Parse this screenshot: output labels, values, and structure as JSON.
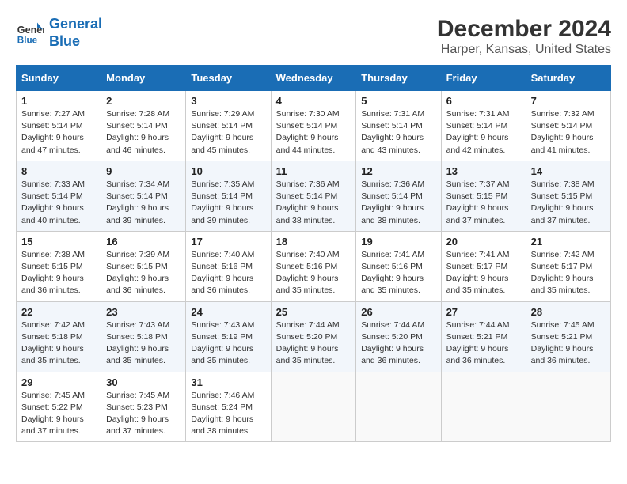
{
  "header": {
    "logo_line1": "General",
    "logo_line2": "Blue",
    "title": "December 2024",
    "subtitle": "Harper, Kansas, United States"
  },
  "calendar": {
    "days_of_week": [
      "Sunday",
      "Monday",
      "Tuesday",
      "Wednesday",
      "Thursday",
      "Friday",
      "Saturday"
    ],
    "weeks": [
      [
        {
          "day": "1",
          "sunrise": "7:27 AM",
          "sunset": "5:14 PM",
          "daylight": "9 hours and 47 minutes."
        },
        {
          "day": "2",
          "sunrise": "7:28 AM",
          "sunset": "5:14 PM",
          "daylight": "9 hours and 46 minutes."
        },
        {
          "day": "3",
          "sunrise": "7:29 AM",
          "sunset": "5:14 PM",
          "daylight": "9 hours and 45 minutes."
        },
        {
          "day": "4",
          "sunrise": "7:30 AM",
          "sunset": "5:14 PM",
          "daylight": "9 hours and 44 minutes."
        },
        {
          "day": "5",
          "sunrise": "7:31 AM",
          "sunset": "5:14 PM",
          "daylight": "9 hours and 43 minutes."
        },
        {
          "day": "6",
          "sunrise": "7:31 AM",
          "sunset": "5:14 PM",
          "daylight": "9 hours and 42 minutes."
        },
        {
          "day": "7",
          "sunrise": "7:32 AM",
          "sunset": "5:14 PM",
          "daylight": "9 hours and 41 minutes."
        }
      ],
      [
        {
          "day": "8",
          "sunrise": "7:33 AM",
          "sunset": "5:14 PM",
          "daylight": "9 hours and 40 minutes."
        },
        {
          "day": "9",
          "sunrise": "7:34 AM",
          "sunset": "5:14 PM",
          "daylight": "9 hours and 39 minutes."
        },
        {
          "day": "10",
          "sunrise": "7:35 AM",
          "sunset": "5:14 PM",
          "daylight": "9 hours and 39 minutes."
        },
        {
          "day": "11",
          "sunrise": "7:36 AM",
          "sunset": "5:14 PM",
          "daylight": "9 hours and 38 minutes."
        },
        {
          "day": "12",
          "sunrise": "7:36 AM",
          "sunset": "5:14 PM",
          "daylight": "9 hours and 38 minutes."
        },
        {
          "day": "13",
          "sunrise": "7:37 AM",
          "sunset": "5:15 PM",
          "daylight": "9 hours and 37 minutes."
        },
        {
          "day": "14",
          "sunrise": "7:38 AM",
          "sunset": "5:15 PM",
          "daylight": "9 hours and 37 minutes."
        }
      ],
      [
        {
          "day": "15",
          "sunrise": "7:38 AM",
          "sunset": "5:15 PM",
          "daylight": "9 hours and 36 minutes."
        },
        {
          "day": "16",
          "sunrise": "7:39 AM",
          "sunset": "5:15 PM",
          "daylight": "9 hours and 36 minutes."
        },
        {
          "day": "17",
          "sunrise": "7:40 AM",
          "sunset": "5:16 PM",
          "daylight": "9 hours and 36 minutes."
        },
        {
          "day": "18",
          "sunrise": "7:40 AM",
          "sunset": "5:16 PM",
          "daylight": "9 hours and 35 minutes."
        },
        {
          "day": "19",
          "sunrise": "7:41 AM",
          "sunset": "5:16 PM",
          "daylight": "9 hours and 35 minutes."
        },
        {
          "day": "20",
          "sunrise": "7:41 AM",
          "sunset": "5:17 PM",
          "daylight": "9 hours and 35 minutes."
        },
        {
          "day": "21",
          "sunrise": "7:42 AM",
          "sunset": "5:17 PM",
          "daylight": "9 hours and 35 minutes."
        }
      ],
      [
        {
          "day": "22",
          "sunrise": "7:42 AM",
          "sunset": "5:18 PM",
          "daylight": "9 hours and 35 minutes."
        },
        {
          "day": "23",
          "sunrise": "7:43 AM",
          "sunset": "5:18 PM",
          "daylight": "9 hours and 35 minutes."
        },
        {
          "day": "24",
          "sunrise": "7:43 AM",
          "sunset": "5:19 PM",
          "daylight": "9 hours and 35 minutes."
        },
        {
          "day": "25",
          "sunrise": "7:44 AM",
          "sunset": "5:20 PM",
          "daylight": "9 hours and 35 minutes."
        },
        {
          "day": "26",
          "sunrise": "7:44 AM",
          "sunset": "5:20 PM",
          "daylight": "9 hours and 36 minutes."
        },
        {
          "day": "27",
          "sunrise": "7:44 AM",
          "sunset": "5:21 PM",
          "daylight": "9 hours and 36 minutes."
        },
        {
          "day": "28",
          "sunrise": "7:45 AM",
          "sunset": "5:21 PM",
          "daylight": "9 hours and 36 minutes."
        }
      ],
      [
        {
          "day": "29",
          "sunrise": "7:45 AM",
          "sunset": "5:22 PM",
          "daylight": "9 hours and 37 minutes."
        },
        {
          "day": "30",
          "sunrise": "7:45 AM",
          "sunset": "5:23 PM",
          "daylight": "9 hours and 37 minutes."
        },
        {
          "day": "31",
          "sunrise": "7:46 AM",
          "sunset": "5:24 PM",
          "daylight": "9 hours and 38 minutes."
        },
        null,
        null,
        null,
        null
      ]
    ]
  }
}
